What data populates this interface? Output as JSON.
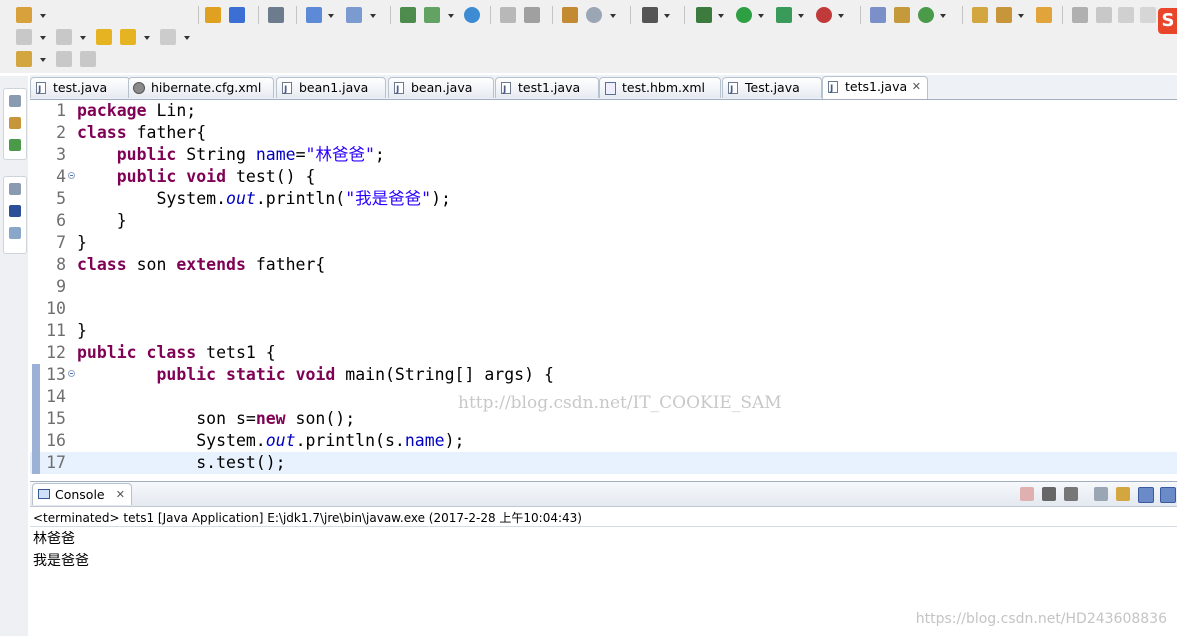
{
  "colors": {
    "keyword": "#7f0055",
    "field": "#0000c0",
    "string": "#2a00ff",
    "current_line": "#e8f2fe",
    "brand": "#e8452b"
  },
  "toolbar": {
    "brand_letter": "S"
  },
  "editor": {
    "tabs": [
      {
        "label": "test.java",
        "icon": "java-file-icon"
      },
      {
        "label": "hibernate.cfg.xml",
        "icon": "hibernate-config-icon"
      },
      {
        "label": "bean1.java",
        "icon": "java-file-icon"
      },
      {
        "label": "bean.java",
        "icon": "java-file-icon"
      },
      {
        "label": "test1.java",
        "icon": "java-file-icon"
      },
      {
        "label": "test.hbm.xml",
        "icon": "hbm-xml-icon"
      },
      {
        "label": "Test.java",
        "icon": "java-file-icon"
      },
      {
        "label": "tets1.java",
        "icon": "java-file-icon",
        "active": true
      }
    ],
    "close_glyph": "✕",
    "lines": [
      {
        "n": "1",
        "tokens": [
          [
            "kw",
            "package"
          ],
          [
            "p",
            " Lin;"
          ]
        ]
      },
      {
        "n": "2",
        "tokens": [
          [
            "kw",
            "class"
          ],
          [
            "p",
            " father{"
          ]
        ]
      },
      {
        "n": "3",
        "tokens": [
          [
            "p",
            "    "
          ],
          [
            "kw",
            "public"
          ],
          [
            "p",
            " String "
          ],
          [
            "fld",
            "name"
          ],
          [
            "p",
            "="
          ],
          [
            "str",
            "\"林爸爸\""
          ],
          [
            "p",
            ";"
          ]
        ]
      },
      {
        "n": "4",
        "fold": true,
        "tokens": [
          [
            "p",
            "    "
          ],
          [
            "kw",
            "public"
          ],
          [
            "p",
            " "
          ],
          [
            "kw",
            "void"
          ],
          [
            "p",
            " test() {"
          ]
        ]
      },
      {
        "n": "5",
        "tokens": [
          [
            "p",
            "        System."
          ],
          [
            "stat",
            "out"
          ],
          [
            "p",
            ".println("
          ],
          [
            "str",
            "\"我是爸爸\""
          ],
          [
            "p",
            ");"
          ]
        ]
      },
      {
        "n": "6",
        "tokens": [
          [
            "p",
            "    }"
          ]
        ]
      },
      {
        "n": "7",
        "tokens": [
          [
            "p",
            "}"
          ]
        ]
      },
      {
        "n": "8",
        "tokens": [
          [
            "kw",
            "class"
          ],
          [
            "p",
            " son "
          ],
          [
            "kw",
            "extends"
          ],
          [
            "p",
            " father{"
          ]
        ]
      },
      {
        "n": "9",
        "tokens": []
      },
      {
        "n": "10",
        "tokens": []
      },
      {
        "n": "11",
        "tokens": [
          [
            "p",
            "}"
          ]
        ]
      },
      {
        "n": "12",
        "tokens": [
          [
            "kw",
            "public"
          ],
          [
            "p",
            " "
          ],
          [
            "kw",
            "class"
          ],
          [
            "p",
            " tets1 {"
          ]
        ]
      },
      {
        "n": "13",
        "fold": true,
        "mark": true,
        "tokens": [
          [
            "p",
            "        "
          ],
          [
            "kw",
            "public"
          ],
          [
            "p",
            " "
          ],
          [
            "kw",
            "static"
          ],
          [
            "p",
            " "
          ],
          [
            "kw",
            "void"
          ],
          [
            "p",
            " main(String[] args) {"
          ]
        ]
      },
      {
        "n": "14",
        "mark": true,
        "tokens": []
      },
      {
        "n": "15",
        "mark": true,
        "tokens": [
          [
            "p",
            "            son s="
          ],
          [
            "kw",
            "new"
          ],
          [
            "p",
            " son();"
          ]
        ]
      },
      {
        "n": "16",
        "mark": true,
        "tokens": [
          [
            "p",
            "            System."
          ],
          [
            "stat",
            "out"
          ],
          [
            "p",
            ".println(s."
          ],
          [
            "fld",
            "name"
          ],
          [
            "p",
            ");"
          ]
        ]
      },
      {
        "n": "17",
        "mark": true,
        "current": true,
        "tokens": [
          [
            "p",
            "            s.test();"
          ]
        ]
      }
    ],
    "watermark": "http://blog.csdn.net/IT_COOKIE_SAM"
  },
  "console": {
    "tab_label": "Console",
    "close_glyph": "✕",
    "terminated": "<terminated> tets1 [Java Application] E:\\jdk1.7\\jre\\bin\\javaw.exe (2017-2-28 上午10:04:43)",
    "output": [
      "林爸爸",
      "我是爸爸"
    ],
    "watermark": "https://blog.csdn.net/HD243608836"
  }
}
